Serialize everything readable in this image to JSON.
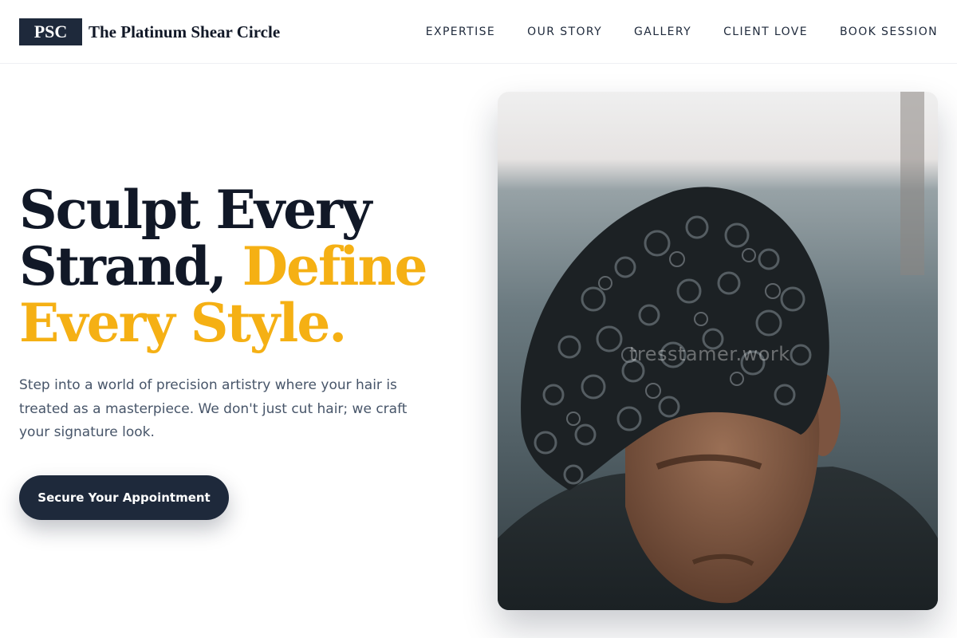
{
  "header": {
    "logo_mark": "PSC",
    "brand_name": "The Platinum Shear Circle",
    "nav": [
      "EXPERTISE",
      "OUR STORY",
      "GALLERY",
      "CLIENT LOVE",
      "BOOK SESSION"
    ]
  },
  "hero": {
    "headline": {
      "line1": "Sculpt Every",
      "line2_plain": "Strand, ",
      "line2_accent": "Define",
      "line3_accent": "Every Style."
    },
    "lead": "Step into a world of precision artistry where your hair is treated as a masterpiece. We don't just cut hair; we craft your signature look.",
    "cta_label": "Secure Your Appointment",
    "image": {
      "description": "man-with-curly-hair-photo",
      "watermark": "tresstamer.work"
    }
  },
  "colors": {
    "primary_dark": "#1e293b",
    "accent_gold": "#f5b014",
    "body_text": "#475569"
  }
}
